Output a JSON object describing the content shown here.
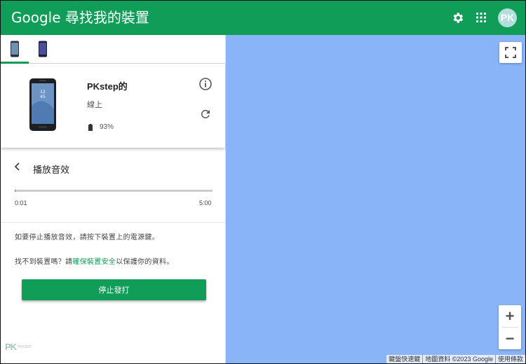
{
  "header": {
    "title": "Google 尋找我的裝置",
    "avatar_text": "PK",
    "icons": [
      "gear-icon",
      "apps-grid-icon"
    ]
  },
  "tabs": [
    {
      "name": "phone-front",
      "active": true
    },
    {
      "name": "phone-dark",
      "active": false
    }
  ],
  "device": {
    "name": "PKstep的",
    "status": "線上",
    "battery": "93%"
  },
  "sound": {
    "title": "播放音效",
    "progress_fraction": 0.003,
    "time_current": "0:01",
    "time_total": "5:00",
    "instruction": "如要停止播放音效，請按下裝置上的電源鍵。",
    "help_prefix": "找不到裝置嗎？請",
    "help_link": "確保裝置安全",
    "help_suffix": "以保護你的資料。",
    "stop_label": "停止發打"
  },
  "watermark": {
    "logo": "PK",
    "small": "PKSTEP"
  },
  "map": {
    "background": "#8ab4f8",
    "zoom_in": "+",
    "zoom_out": "−",
    "attribution": [
      "鍵盤快速鍵",
      "地圖資料 ©2023 Google",
      "使用條款"
    ]
  },
  "colors": {
    "brand": "#0f9d58",
    "map": "#8ab4f8"
  }
}
